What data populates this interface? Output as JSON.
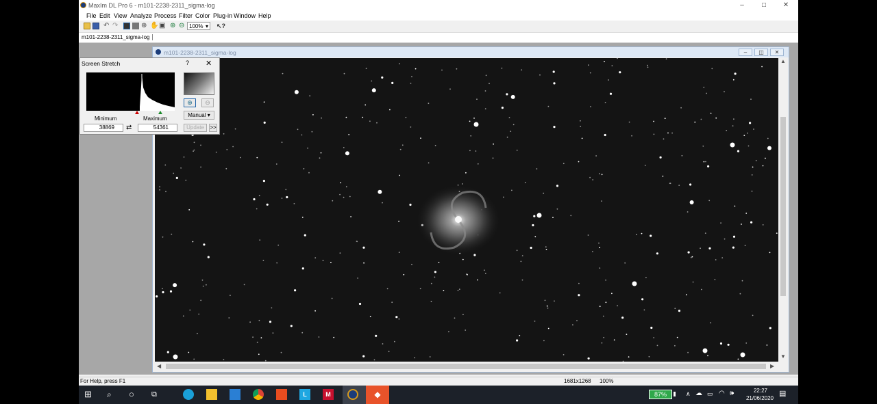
{
  "window": {
    "title": "MaxIm DL Pro 6 - m101-2238-2311_sigma-log",
    "minimize": "–",
    "maximize": "□",
    "close": "✕"
  },
  "menu": [
    "File",
    "Edit",
    "View",
    "Analyze",
    "Process",
    "Filter",
    "Color",
    "Plug-in",
    "Window",
    "Help"
  ],
  "toolbar": {
    "zoom": "100%",
    "icons": [
      "open-icon",
      "save-icon",
      "undo-icon",
      "redo-icon",
      "screen-stretch-icon",
      "image-info-icon",
      "crosshair-icon",
      "pan-icon",
      "camera-icon",
      "zoom-in-icon",
      "zoom-out-icon",
      "help-pointer-icon"
    ]
  },
  "document_tab": "m101-2238-2311_sigma-log",
  "image_window": {
    "title": "m101-2238-2311_sigma-log"
  },
  "screen_stretch": {
    "title": "Screen Stretch",
    "help": "?",
    "close": "✕",
    "minimum_label": "Minimum",
    "maximum_label": "Maximum",
    "minimum_value": "38869",
    "maximum_value": "54361",
    "mode": "Manual",
    "update_label": "Update",
    "expand_label": ">>"
  },
  "status": {
    "help_text": "For Help, press F1",
    "dimensions": "1681x1268",
    "zoom": "100%"
  },
  "taskbar": {
    "battery": "87%",
    "time": "22:27",
    "date": "21/06/2020",
    "apps": [
      "edge-icon",
      "file-explorer-icon",
      "mail-icon",
      "chrome-icon",
      "office-icon",
      "l-app-icon",
      "mcafee-icon",
      "maxim-dl-icon",
      "anydesk-icon"
    ]
  },
  "colors": {
    "taskbar": "#1c2129",
    "battery": "#2fa84a",
    "sky": "#141414"
  }
}
